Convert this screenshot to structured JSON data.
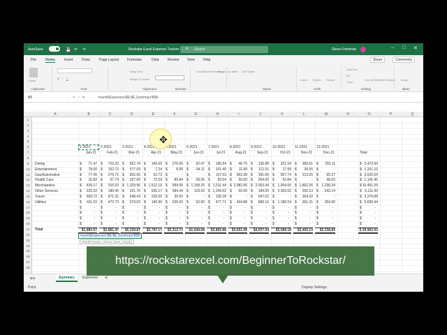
{
  "titlebar": {
    "autosave": "AutoSave",
    "title": "Rockstar Excel Expense Tracker",
    "search": "Search",
    "user": "Steve Friedman"
  },
  "tabs": [
    "File",
    "Home",
    "Insert",
    "Draw",
    "Page Layout",
    "Formulas",
    "Data",
    "Review",
    "View",
    "Help"
  ],
  "tabs_right": {
    "share": "Share",
    "comments": "Comments"
  },
  "ribbon": {
    "groups": [
      "Clipboard",
      "Font",
      "Alignment",
      "Number",
      "Styles",
      "Cells",
      "Editing",
      "Ideas"
    ],
    "paste": "Paste",
    "wrap": "Wrap Text",
    "merge": "Merge & Center",
    "cond": "Conditional Formatting",
    "fmt_table": "Format as Table",
    "cell_styles": "Cell Styles",
    "insert": "Insert",
    "delete": "Delete",
    "format": "Format",
    "autosum": "AutoSum",
    "fill": "Fill",
    "clear": "Clear",
    "sort": "Sort & Filter",
    "find": "Find & Select",
    "ideas": "Ideas"
  },
  "formula_bar": {
    "name_box": "B6",
    "formula": "=sumif(Expenses!$E:$E,Summary!B$6"
  },
  "columns": [
    "A",
    "B",
    "C",
    "D",
    "E",
    "F",
    "G",
    "H",
    "I",
    "J",
    "K",
    "L",
    "M",
    "N",
    "O",
    "P",
    "Q"
  ],
  "rows": [
    "1",
    "2",
    "3",
    "4",
    "5",
    "6",
    "7",
    "8",
    "9",
    "10",
    "11",
    "12",
    "13",
    "14",
    "15",
    "16",
    "17",
    "18",
    "19",
    "20",
    "21",
    "22",
    "23",
    "24",
    "25",
    "26",
    "27",
    "28"
  ],
  "sheet": {
    "date_codes": [
      "1-2021",
      "2-2021",
      "3-2021",
      "4-2021",
      "5-2021",
      "6-2021",
      "7-2021",
      "8-2021",
      "9-2021",
      "10-2021",
      "11-2021",
      "12-2021"
    ],
    "months": [
      "Jan-21",
      "Feb-21",
      "Mar-21",
      "Apr-21",
      "May-21",
      "Jun-21",
      "Jul-21",
      "Aug-21",
      "Sep-21",
      "Oct-21",
      "Nov-21",
      "Dec-21"
    ],
    "total_header": "Total",
    "categories": [
      {
        "name": "Dining",
        "values": [
          "71.47",
          "710.32",
          "822.74",
          "145.65",
          "276.66",
          "92.47",
          "186.84",
          "46.75",
          "136.88",
          "321.54",
          "369.51",
          "293.11"
        ],
        "total": "3,473.94"
      },
      {
        "name": "Entertainment",
        "values": [
          "78.00",
          "152.73",
          "577.09",
          "7.24",
          "8.95",
          "94.11",
          "101.40",
          "11.99",
          "112.01",
          "17.99",
          "39.55",
          "-"
        ],
        "total": "1,201.10"
      },
      {
        "name": "Gas/Automotive",
        "values": [
          "77.45",
          "279.71",
          "832.99",
          "52.73",
          "-",
          "-",
          "137.53",
          "952.38",
          "391.69",
          "657.74",
          "213.05",
          "65.37"
        ],
        "total": "3,620.64"
      },
      {
        "name": "Health Care",
        "values": [
          "16.82",
          "97.74",
          "327.90",
          "72.29",
          "80.84",
          "28.95",
          "93.04",
          "50.00",
          "264.00",
          "63.84",
          "-",
          "46.03"
        ],
        "total": "1,141.45"
      },
      {
        "name": "Merchandise",
        "values": [
          "439.17",
          "316.53",
          "$1,329.96",
          "$1,512.19",
          "994.95",
          "$1,158.25",
          "$1,511.44",
          "$2,082.96",
          "$2,003.44",
          "$1,004.00",
          "$1,862.36",
          "$1,236.34"
        ],
        "total": "$15,451.59"
      },
      {
        "name": "Other Services",
        "values": [
          "229.32",
          "180.40",
          "221.76",
          "636.17",
          "394.34",
          "118.00",
          "$1,249.62",
          "50.00",
          "184.00",
          "$2,363.63",
          "200.13",
          "243.14"
        ],
        "total": "6,111.49"
      },
      {
        "name": "Travel",
        "values": [
          "659.72",
          "671.31",
          "648.43",
          "230.00",
          "30.00",
          "-",
          "135.28",
          "-",
          "547.02",
          "-",
          "354.32",
          "-"
        ],
        "total": "3,276.88"
      },
      {
        "name": "Utilities",
        "values": [
          "411.02",
          "472.73",
          "579.02",
          "140.90",
          "526.93",
          "52.90",
          "477.71",
          "434.88",
          "898.10",
          "$1,180.04",
          "361.31",
          "354.90"
        ],
        "total": "5,690.44"
      }
    ],
    "total_label": "Total",
    "month_totals": [
      "$1,982.97",
      "$2,881.47",
      "$5,339.87",
      "$2,797.17",
      "$2,312.71",
      "$1,544.68",
      "$3,892.86",
      "$3,651.96",
      "$4,537.94",
      "$5,589.18",
      "$3,400.23",
      "$2,238.89"
    ],
    "grand_total": "$ 39,962.93",
    "edit_formula": "=sumif(Expenses!$E:$E,Summary!B$6",
    "tooltip": "SUMIF(range, criteria, [sum_range])"
  },
  "sheet_tabs": [
    "Summary",
    "Expenses"
  ],
  "status": {
    "mode": "Point",
    "display": "Display Settings"
  },
  "overlay": {
    "url": "https://rockstarexcel.com/BeginnerToRockstar/"
  },
  "colors": {
    "excel_green": "#1e7145",
    "banner": "#3f6f3e"
  }
}
